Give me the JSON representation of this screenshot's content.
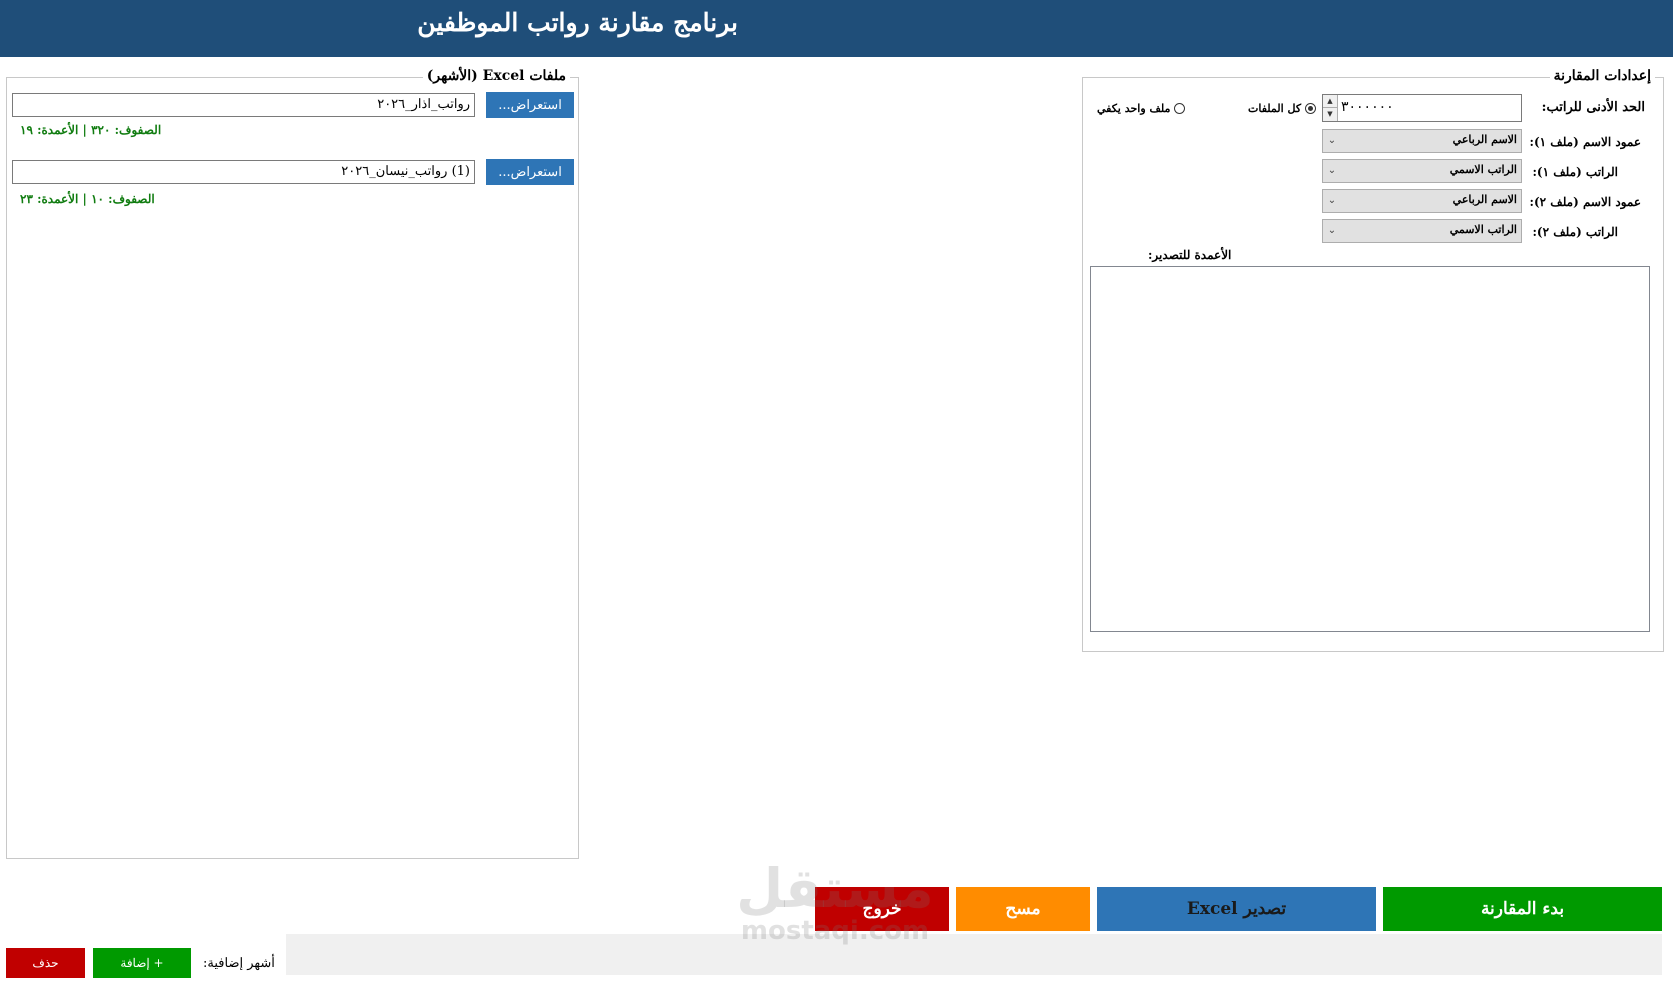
{
  "app": {
    "title": "برنامج مقارنة رواتب الموظفين"
  },
  "files_panel": {
    "label": "ملفات Excel (الأشهر)",
    "files": [
      {
        "path": "رواتب_اذار_٢٠٢٦",
        "browse_label": "استعراض...",
        "stats": "الصفوف: ٣٢٠ | الأعمدة: ١٩"
      },
      {
        "path": "(1) رواتب_نيسان_٢٠٢٦",
        "browse_label": "استعراض...",
        "stats": "الصفوف: ١٠ | الأعمدة: ٢٣"
      }
    ]
  },
  "settings": {
    "label": "إعدادات المقارنة",
    "min_salary_label": "الحد الأدنى للراتب:",
    "min_salary_value": "٣٠٠٠٠٠٠",
    "radio_all": "كل الملفات",
    "radio_one": "ملف واحد يكفي",
    "radio_selected": "all",
    "name_col_1_label": "عمود الاسم (ملف ١):",
    "name_col_1_value": "الاسم الرباعي",
    "salary_1_label": "الراتب (ملف ١):",
    "salary_1_value": "الراتب الاسمي",
    "name_col_2_label": "عمود الاسم (ملف ٢):",
    "name_col_2_value": "الاسم الرباعي",
    "salary_2_label": "الراتب (ملف ٢):",
    "salary_2_value": "الراتب الاسمي",
    "export_cols_label": "الأعمدة للتصدير:"
  },
  "actions": {
    "start": "بدء المقارنة",
    "export": "تصدير Excel",
    "clear": "مسح",
    "exit": "خروج"
  },
  "extra_months": {
    "label": "أشهر إضافية:",
    "add": "+ إضافة",
    "delete": "حذف"
  },
  "colors": {
    "header": "#1f4e79",
    "browse": "#2e75b6",
    "start": "#009a00",
    "export": "#2e75b6",
    "clear": "#ff8c00",
    "exit": "#c00000",
    "stats": "#107c10"
  },
  "watermark": {
    "line1": "مستقل",
    "line2": "mostaqi.com"
  }
}
